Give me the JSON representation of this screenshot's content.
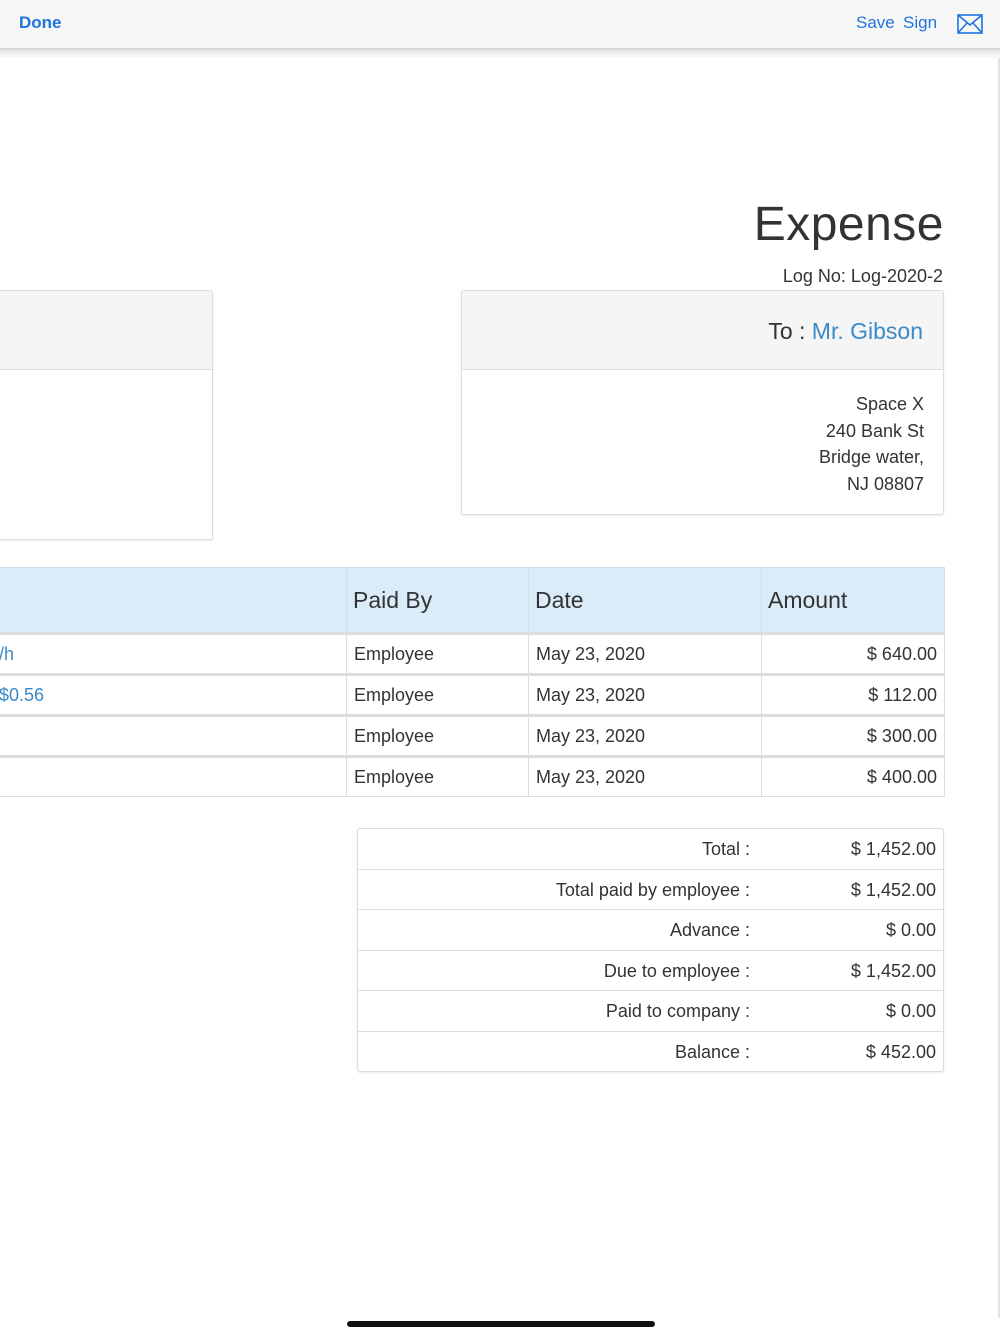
{
  "toolbar": {
    "done_label": "Done",
    "save_label": "Save",
    "sign_label": "Sign",
    "mail_icon": "envelope-icon"
  },
  "document": {
    "title": "Expense",
    "log_no": "Log No: Log-2020-2",
    "to": {
      "prefix": "To : ",
      "name": "Mr. Gibson",
      "address": [
        "Space X",
        "240 Bank St",
        "Bridge water,",
        "NJ 08807"
      ]
    },
    "table": {
      "headers": [
        "Paid By",
        "Date",
        "Amount"
      ],
      "rows": [
        {
          "desc": "/h",
          "paid_by": "Employee",
          "date": "May 23, 2020",
          "amount": "$ 640.00"
        },
        {
          "desc": "$0.56",
          "paid_by": "Employee",
          "date": "May 23, 2020",
          "amount": "$ 112.00"
        },
        {
          "desc": "",
          "paid_by": "Employee",
          "date": "May 23, 2020",
          "amount": "$ 300.00"
        },
        {
          "desc": "",
          "paid_by": "Employee",
          "date": "May 23, 2020",
          "amount": "$ 400.00"
        }
      ]
    },
    "totals": [
      {
        "label": "Total :",
        "value": "$ 1,452.00"
      },
      {
        "label": "Total paid by employee :",
        "value": "$ 1,452.00"
      },
      {
        "label": "Advance :",
        "value": "$ 0.00"
      },
      {
        "label": "Due to employee :",
        "value": "$ 1,452.00"
      },
      {
        "label": "Paid to company :",
        "value": "$ 0.00"
      },
      {
        "label": "Balance :",
        "value": "$ 452.00"
      }
    ]
  }
}
